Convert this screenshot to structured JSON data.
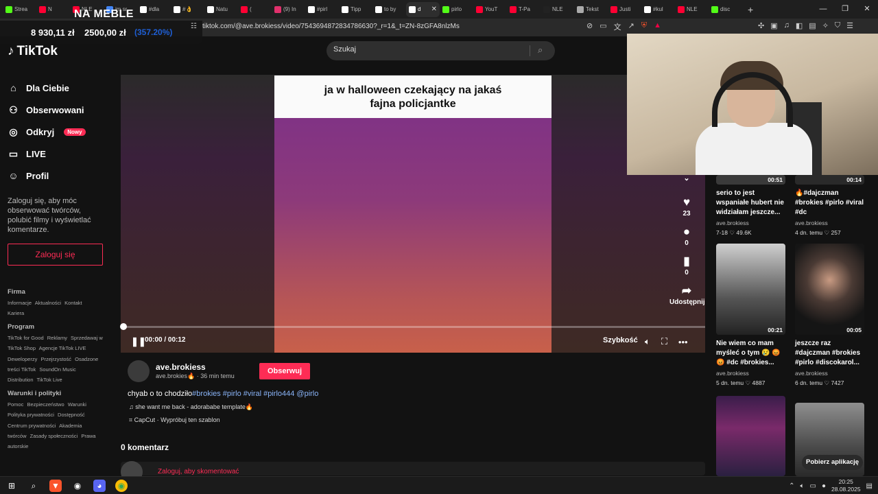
{
  "browser": {
    "tabs": [
      {
        "label": "Strea",
        "color": "#53fc18"
      },
      {
        "label": "N",
        "color": "#ff0033"
      },
      {
        "label": "NLE",
        "color": "#ff0033"
      },
      {
        "label": "im sr",
        "color": "#4285f4"
      },
      {
        "label": "#dla",
        "color": "#ffffff"
      },
      {
        "label": "#👌",
        "color": "#ffffff"
      },
      {
        "label": "Natu",
        "color": "#ffffff"
      },
      {
        "label": "(",
        "color": "#ff0033"
      },
      {
        "label": "(9) In",
        "color": "#e1306c"
      },
      {
        "label": "#pirl",
        "color": "#ffffff"
      },
      {
        "label": "Tipp",
        "color": "#ffffff"
      },
      {
        "label": "to by",
        "color": "#ffffff"
      },
      {
        "label": "d",
        "color": "#ffffff",
        "active": true
      },
      {
        "label": "pirlo",
        "color": "#53fc18"
      },
      {
        "label": "YouT",
        "color": "#ff0033"
      },
      {
        "label": "T-Pa",
        "color": "#ff0033"
      },
      {
        "label": "NLE",
        "color": "#222222"
      },
      {
        "label": "Tekst",
        "color": "#aaaaaa"
      },
      {
        "label": "Justi",
        "color": "#ff0033"
      },
      {
        "label": "#kul",
        "color": "#ffffff"
      },
      {
        "label": "NLE",
        "color": "#ff0033"
      },
      {
        "label": "disc",
        "color": "#53fc18"
      }
    ],
    "url": "tiktok.com/@ave.brokiess/video/7543694872834786630?_r=1&_t=ZN-8zGFA8nlzMs"
  },
  "overlay": {
    "stream_title": "NA MEBLE",
    "amount_a": "8 930,11 zł",
    "amount_b": "2500,00 zł",
    "amount_c": "(357.20%)"
  },
  "tiktok": {
    "logo": "TikTok",
    "search_placeholder": "Szukaj",
    "nav": [
      {
        "label": "Dla Ciebie",
        "icon": "home-icon"
      },
      {
        "label": "Obserwowani",
        "icon": "users-icon"
      },
      {
        "label": "Odkryj",
        "icon": "compass-icon",
        "badge": "Nowy"
      },
      {
        "label": "LIVE",
        "icon": "live-icon"
      },
      {
        "label": "Profil",
        "icon": "user-icon"
      }
    ],
    "login_prompt": "Zaloguj się, aby móc obserwować twórców, polubić filmy i wyświetlać komentarze.",
    "login_button": "Zaloguj się",
    "footer": {
      "firma_h": "Firma",
      "firma": [
        "Informacje",
        "Aktualności",
        "Kontakt",
        "Kariera"
      ],
      "program_h": "Program",
      "program": [
        "TikTok for Good",
        "Reklamy",
        "Sprzedawaj w TikTok Shop",
        "Agencje TikTok LIVE",
        "Deweloperzy",
        "Przejrzystość",
        "Osadzone treści TikTok",
        "SoundOn Music Distribution",
        "TikTok Live"
      ],
      "warunki_h": "Warunki i polityki",
      "warunki": [
        "Pomoc",
        "Bezpieczeństwo",
        "Warunki",
        "Polityka prywatności",
        "Dostępność",
        "Centrum prywatności",
        "Akademia twórców",
        "Zasady społeczności",
        "Prawa autorskie"
      ]
    },
    "video": {
      "caption_line1": "ja w halloween czekający na jakaś",
      "caption_line2": "fajna policjantke",
      "time": "00:00 / 00:12",
      "progress": 0,
      "speed_label": "Szybkość",
      "likes": "23",
      "comments": "0",
      "saves": "0",
      "share_label": "Udostępnij"
    },
    "author": {
      "name": "ave.brokiess",
      "sub": "ave.brokies🔥 · 36 min temu",
      "follow_label": "Obserwuj"
    },
    "description": {
      "text": "chyab o to chodziło",
      "tags": "#brokies #pirlo #viral #pirlo444 @pirlo"
    },
    "music": "♫ she want me back - adorababe template🔥",
    "capcut": "CapCut · Wypróbuj ten szablon",
    "comments_header": "0 komentarz",
    "comment_login": "Zaloguj, aby skomentować",
    "related": [
      {
        "duration": "00:51",
        "title": "serio to jest wspaniałe hubert nie widziałam jeszcze...",
        "author": "ave.brokiess",
        "date": "7-18",
        "likes": "49.6K"
      },
      {
        "duration": "00:14",
        "title": "🔥#dajczman #brokies #pirlo #viral #dc",
        "author": "ave.brokiess",
        "date": "4 dn. temu",
        "likes": "257"
      },
      {
        "duration": "00:21",
        "title": "Nie wiem co mam myśleć o tym 😢 😡 😡 #dc #brokies...",
        "author": "ave.brokiess",
        "date": "5 dn. temu",
        "likes": "4887"
      },
      {
        "duration": "00:05",
        "title": "jeszcze raz #dajczman #brokies #pirlo #discokarol...",
        "author": "ave.brokiess",
        "date": "6 dn. temu",
        "likes": "7427"
      }
    ],
    "get_app": "Pobierz aplikację"
  },
  "taskbar": {
    "time": "20:25",
    "date": "28.08.2025"
  }
}
